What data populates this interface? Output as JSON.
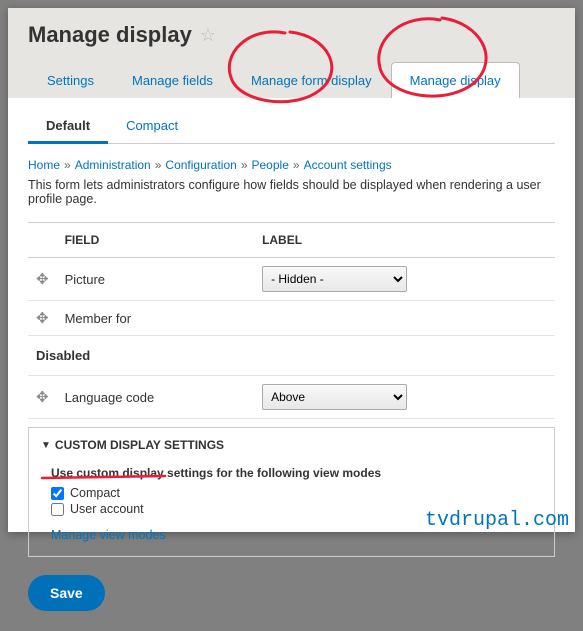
{
  "title": "Manage display",
  "tabs": [
    {
      "label": "Settings"
    },
    {
      "label": "Manage fields"
    },
    {
      "label": "Manage form display"
    },
    {
      "label": "Manage display"
    }
  ],
  "subtabs": [
    {
      "label": "Default"
    },
    {
      "label": "Compact"
    }
  ],
  "breadcrumb": {
    "home": "Home",
    "admin": "Administration",
    "config": "Configuration",
    "people": "People",
    "account": "Account settings"
  },
  "description": "This form lets administrators configure how fields should be displayed when rendering a user profile page.",
  "table": {
    "headers": {
      "field": "FIELD",
      "label": "LABEL"
    },
    "rows": [
      {
        "name": "Picture",
        "select": "- Hidden -"
      },
      {
        "name": "Member for",
        "select": null
      }
    ],
    "disabled_header": "Disabled",
    "disabled_rows": [
      {
        "name": "Language code",
        "select": "Above"
      }
    ]
  },
  "custom": {
    "summary": "CUSTOM DISPLAY SETTINGS",
    "label": "Use custom display settings for the following view modes",
    "options": [
      {
        "label": "Compact",
        "checked": true
      },
      {
        "label": "User account",
        "checked": false
      }
    ],
    "link": "Manage view modes"
  },
  "save": "Save",
  "watermark": "tvdrupal.com"
}
